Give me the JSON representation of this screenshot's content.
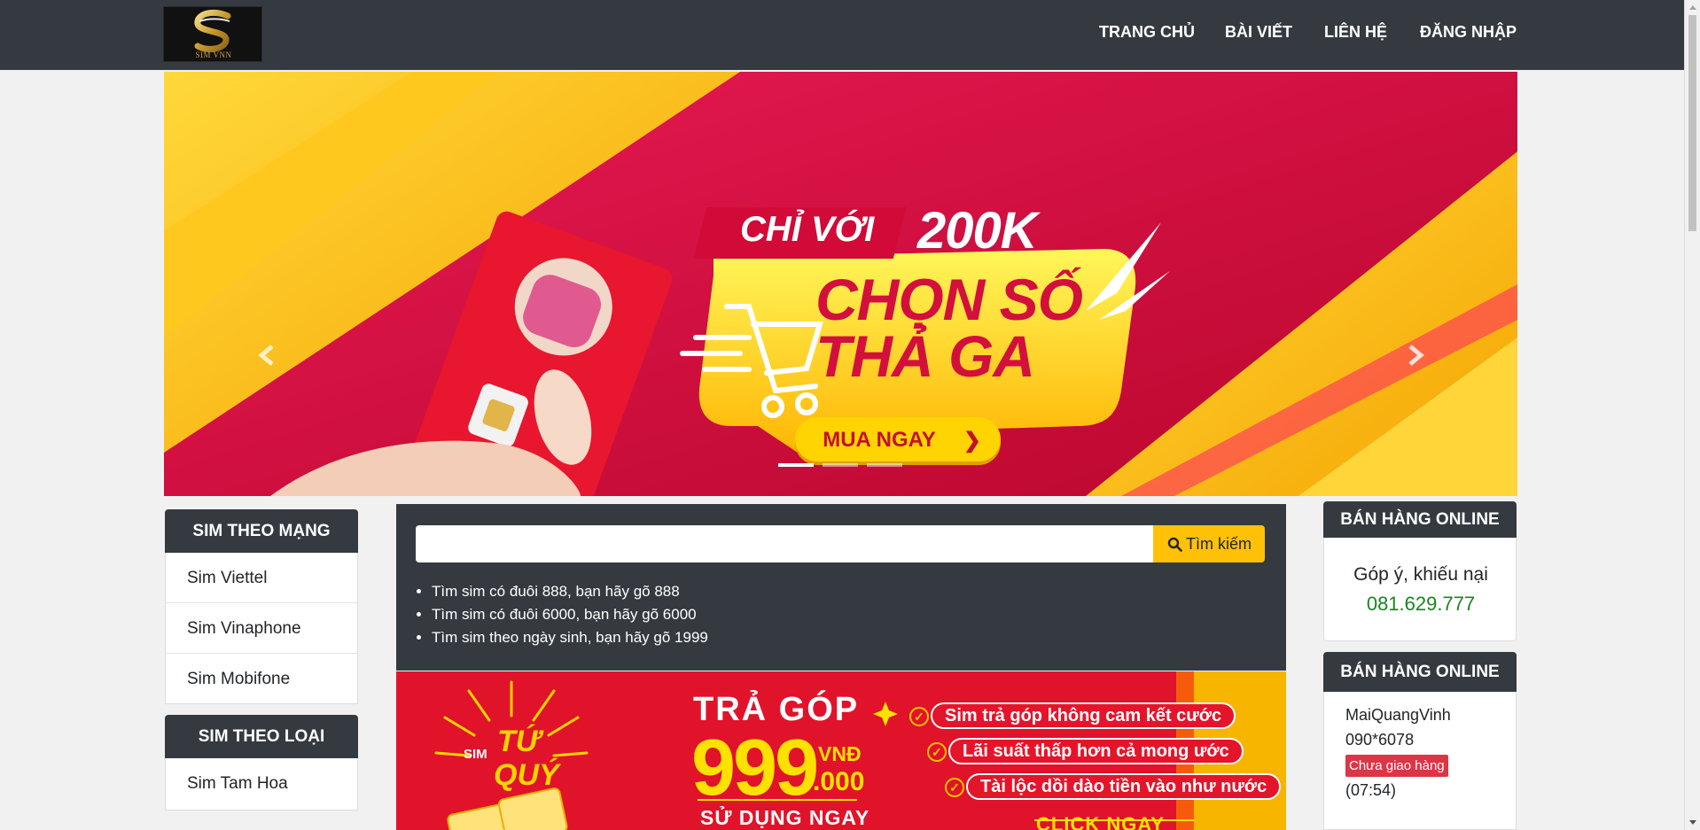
{
  "brand": {
    "logo_text": "SIM VNN",
    "logo_letter": "S"
  },
  "nav": {
    "items": [
      {
        "label": "TRANG CHỦ"
      },
      {
        "label": "BÀI VIẾT"
      },
      {
        "label": "LIÊN HỆ"
      },
      {
        "label": "ĐĂNG NHẬP"
      }
    ]
  },
  "hero": {
    "ribbon": "CHỈ VỚI",
    "price": "200K",
    "headline_line1": "CHỌN SỐ",
    "headline_line2": "THẢ GA",
    "button": "MUA NGAY",
    "button_arrow": "❯",
    "prev_icon": "chevron-left-icon",
    "next_icon": "chevron-right-icon",
    "slides": 3,
    "active_slide": 1
  },
  "sidebar_left": {
    "network": {
      "title": "SIM THEO MẠNG",
      "items": [
        "Sim Viettel",
        "Sim Vinaphone",
        "Sim Mobifone"
      ]
    },
    "type": {
      "title": "SIM THEO LOẠI",
      "items": [
        "Sim Tam Hoa"
      ]
    }
  },
  "search": {
    "value": "",
    "placeholder": "",
    "button": "Tìm kiếm",
    "icon": "search-icon",
    "tips": [
      "Tìm sim có đuôi 888, bạn hãy gõ 888",
      "Tìm sim có đuôi 6000, bạn hãy gõ 6000",
      "Tìm sim theo ngày sinh, bạn hãy gõ 1999"
    ]
  },
  "promo": {
    "sim": "SIM",
    "tu": "TỨ",
    "quy": "QUÝ",
    "tra_gop": "TRẢ GÓP",
    "amount": "999",
    "vnd": "VNĐ",
    "thousand": ".000",
    "su_dung": "SỬ DỤNG NGAY",
    "benefits": [
      "Sim trả góp không cam kết cước",
      "Lãi suất thấp hơn cả mong ước",
      "Tài lộc dồi dào tiền vào như nước"
    ],
    "cta": "CLICK NGAY"
  },
  "sidebar_right": {
    "contact": {
      "title": "BÁN HÀNG ONLINE",
      "label": "Góp ý, khiếu nại",
      "phone": "081.629.777"
    },
    "orders": {
      "title": "BÁN HÀNG ONLINE",
      "latest": {
        "name": "MaiQuangVinh",
        "phone": "090*6078",
        "status": "Chưa giao hàng",
        "time": "(07:54)"
      }
    }
  },
  "colors": {
    "nav_bg": "#343a40",
    "accent_yellow": "#ffc107",
    "phone_green": "#19851f",
    "badge_red": "#dc3545",
    "hero_red": "#d10a38",
    "hero_yellow": "#ffd400"
  }
}
